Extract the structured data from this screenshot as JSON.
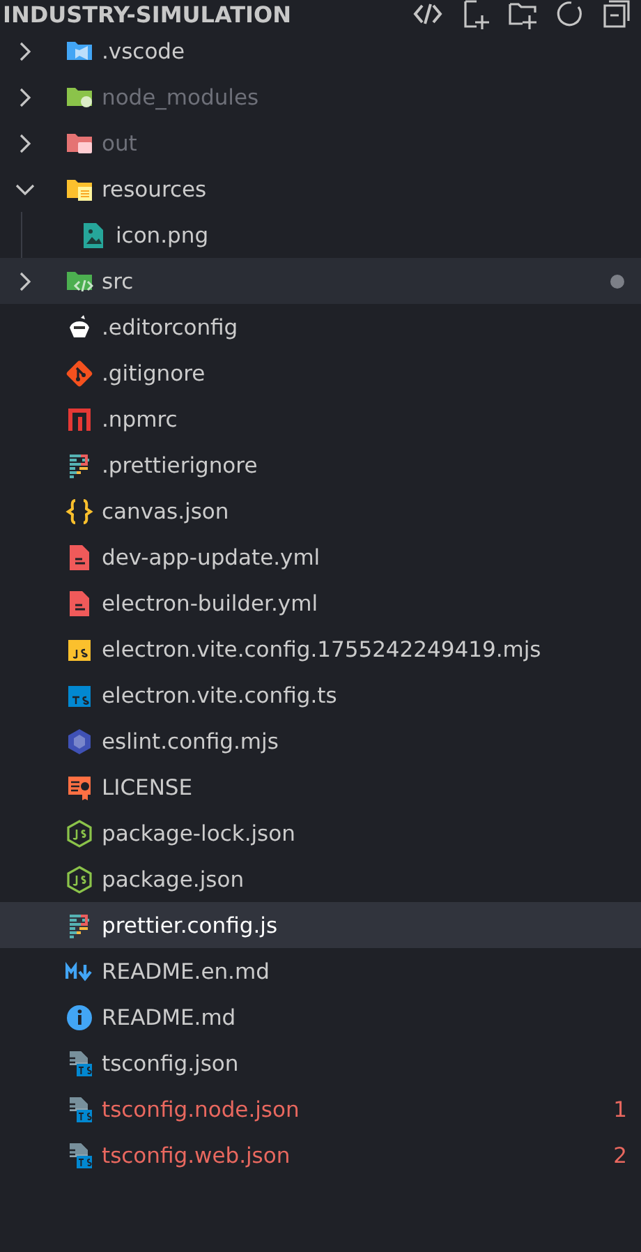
{
  "explorer": {
    "title": "INDUSTRY-SIMULATION",
    "items": [
      {
        "name": ".vscode",
        "kind": "vscode",
        "expanded": false,
        "ignored": false,
        "hovered": false,
        "selected": false
      },
      {
        "name": "node_modules",
        "kind": "node",
        "expanded": false,
        "ignored": true,
        "hovered": false,
        "selected": false
      },
      {
        "name": "out",
        "kind": "out",
        "expanded": false,
        "ignored": true,
        "hovered": false,
        "selected": false
      },
      {
        "name": "resources",
        "kind": "resources",
        "expanded": true,
        "ignored": false,
        "hovered": false,
        "selected": false,
        "children": [
          {
            "name": "icon.png",
            "kind": "image",
            "ignored": false,
            "hovered": false,
            "selected": false
          }
        ]
      },
      {
        "name": "src",
        "kind": "src",
        "expanded": false,
        "ignored": false,
        "hovered": true,
        "selected": false,
        "modified": true
      },
      {
        "name": ".editorconfig",
        "kind": "editorconfig",
        "ignored": false,
        "hovered": false,
        "selected": false
      },
      {
        "name": ".gitignore",
        "kind": "git",
        "ignored": false,
        "hovered": false,
        "selected": false
      },
      {
        "name": ".npmrc",
        "kind": "npm",
        "ignored": false,
        "hovered": false,
        "selected": false
      },
      {
        "name": ".prettierignore",
        "kind": "prettier",
        "ignored": false,
        "hovered": false,
        "selected": false
      },
      {
        "name": "canvas.json",
        "kind": "json",
        "ignored": false,
        "hovered": false,
        "selected": false
      },
      {
        "name": "dev-app-update.yml",
        "kind": "yaml",
        "ignored": false,
        "hovered": false,
        "selected": false
      },
      {
        "name": "electron-builder.yml",
        "kind": "yaml",
        "ignored": false,
        "hovered": false,
        "selected": false
      },
      {
        "name": "electron.vite.config.1755242249419.mjs",
        "kind": "js",
        "ignored": false,
        "hovered": false,
        "selected": false
      },
      {
        "name": "electron.vite.config.ts",
        "kind": "ts",
        "ignored": false,
        "hovered": false,
        "selected": false
      },
      {
        "name": "eslint.config.mjs",
        "kind": "eslint",
        "ignored": false,
        "hovered": false,
        "selected": false
      },
      {
        "name": "LICENSE",
        "kind": "license",
        "ignored": false,
        "hovered": false,
        "selected": false
      },
      {
        "name": "package-lock.json",
        "kind": "nodejs",
        "ignored": false,
        "hovered": false,
        "selected": false
      },
      {
        "name": "package.json",
        "kind": "nodejs",
        "ignored": false,
        "hovered": false,
        "selected": false
      },
      {
        "name": "prettier.config.js",
        "kind": "prettier",
        "ignored": false,
        "hovered": false,
        "selected": true
      },
      {
        "name": "README.en.md",
        "kind": "markdown",
        "ignored": false,
        "hovered": false,
        "selected": false
      },
      {
        "name": "README.md",
        "kind": "info",
        "ignored": false,
        "hovered": false,
        "selected": false
      },
      {
        "name": "tsconfig.json",
        "kind": "tsconfig",
        "ignored": false,
        "hovered": false,
        "selected": false
      },
      {
        "name": "tsconfig.node.json",
        "kind": "tsconfig",
        "ignored": false,
        "hovered": false,
        "selected": false,
        "problems": "1"
      },
      {
        "name": "tsconfig.web.json",
        "kind": "tsconfig",
        "ignored": false,
        "hovered": false,
        "selected": false,
        "problems": "2"
      }
    ]
  }
}
